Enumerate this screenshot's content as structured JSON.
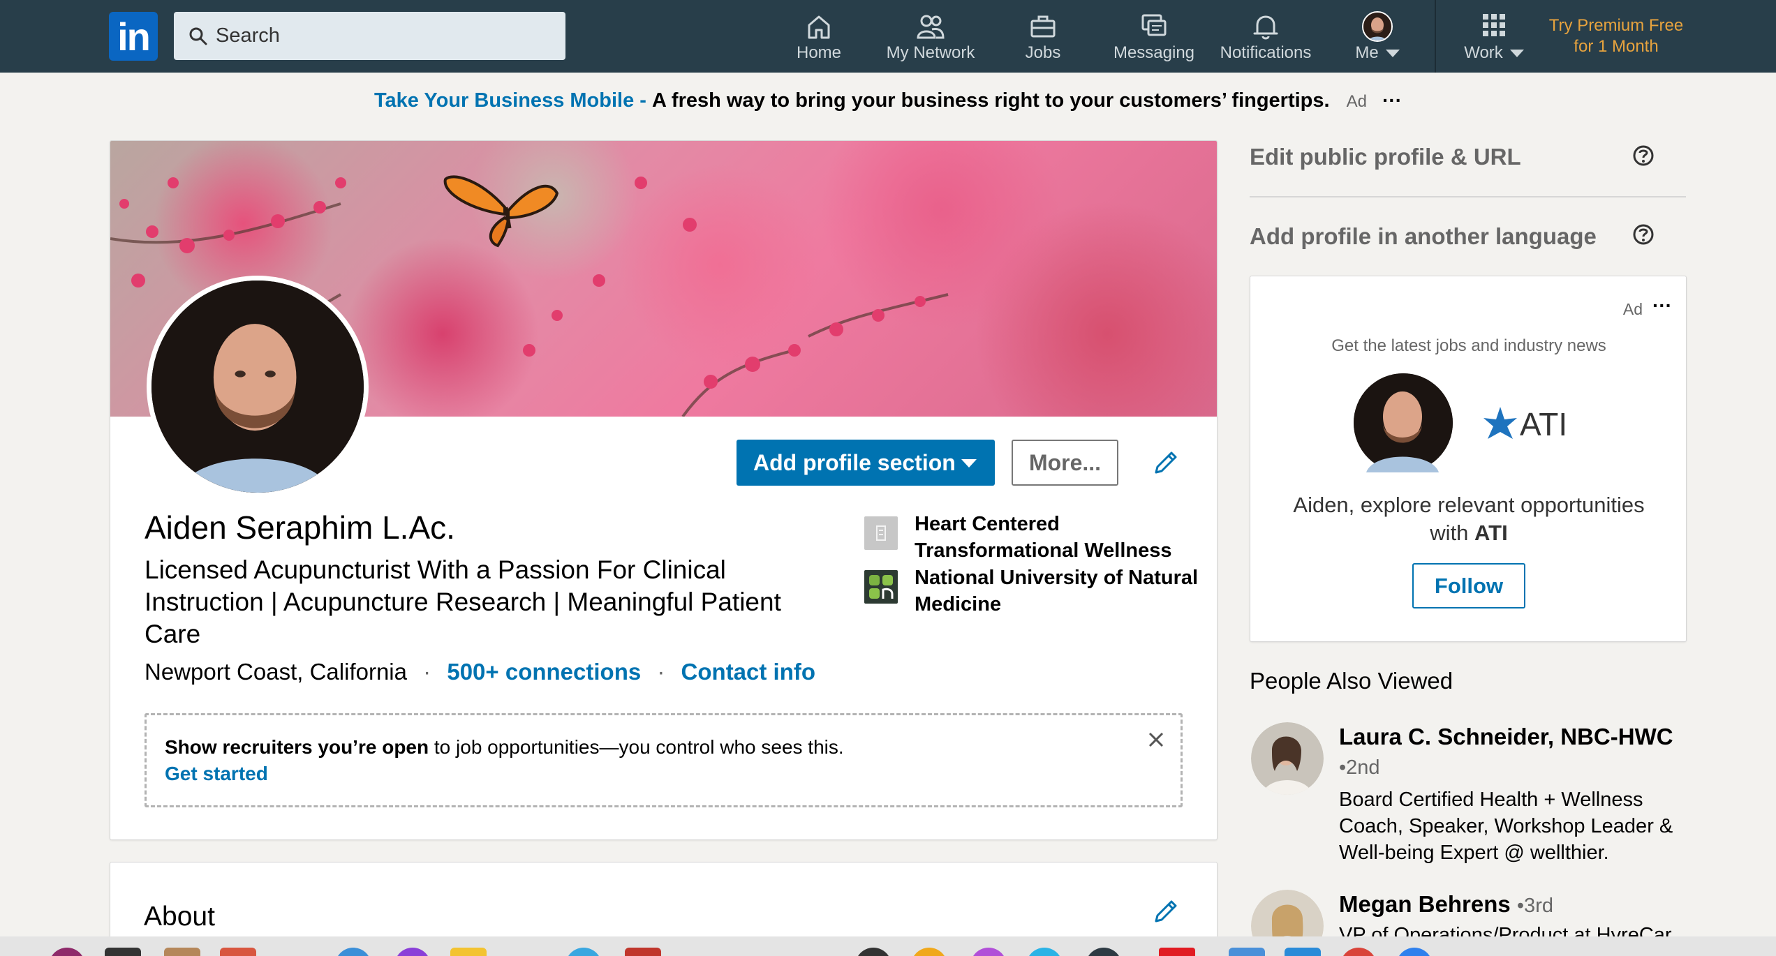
{
  "nav": {
    "logo_text": "in",
    "search_placeholder": "Search",
    "items": [
      {
        "label": "Home",
        "icon": "home-icon"
      },
      {
        "label": "My Network",
        "icon": "network-icon"
      },
      {
        "label": "Jobs",
        "icon": "briefcase-icon"
      },
      {
        "label": "Messaging",
        "icon": "messaging-icon"
      },
      {
        "label": "Notifications",
        "icon": "bell-icon"
      },
      {
        "label": "Me",
        "icon": "avatar"
      },
      {
        "label": "Work",
        "icon": "grid-icon"
      }
    ],
    "premium_line1": "Try Premium Free",
    "premium_line2": "for 1 Month"
  },
  "adbar": {
    "link": "Take Your Business Mobile -",
    "text": "A fresh way to bring your business right to your customers’ fingertips.",
    "tag": "Ad",
    "dots": "···"
  },
  "profile": {
    "add_section_label": "Add profile section",
    "more_label": "More...",
    "name": "Aiden Seraphim L.Ac.",
    "headline": "Licensed Acupuncturist With a Passion For Clinical Instruction | Acupuncture Research | Meaningful Patient Care",
    "location": "Newport Coast, California",
    "connections": "500+ connections",
    "contact_info": "Contact info",
    "orgs": [
      {
        "name": "Heart Centered Transformational Wellness"
      },
      {
        "name": "National University of Natural Medicine"
      }
    ],
    "recruiter_bold": "Show recruiters you’re open",
    "recruiter_text": " to job opportunities—you control who sees this.",
    "get_started": "Get started"
  },
  "about": {
    "title": "About"
  },
  "rail": {
    "edit_public_profile": "Edit public profile & URL",
    "add_language": "Add profile in another language",
    "ad": {
      "tag": "Ad",
      "dots": "···",
      "subtitle": "Get the latest jobs and industry news",
      "logo_text": "ATI",
      "message_prefix": "Aiden, explore relevant opportunities with ",
      "message_company": "ATI",
      "follow_label": "Follow"
    },
    "people_also_viewed": "People Also Viewed",
    "people": [
      {
        "name": "Laura C. Schneider, NBC-HWC",
        "degree": "•2nd",
        "headline": "Board Certified Health + Wellness Coach, Speaker, Workshop Leader & Well-being Expert @ wellthier."
      },
      {
        "name": "Megan Behrens",
        "degree": "•3rd",
        "headline": "VP of Operations/Product at HyreCar"
      }
    ]
  },
  "colors": {
    "nav_bg": "#283e4a",
    "brand_blue": "#0073b1",
    "premium_gold": "#e7a33e",
    "page_bg": "#f3f2ef"
  }
}
